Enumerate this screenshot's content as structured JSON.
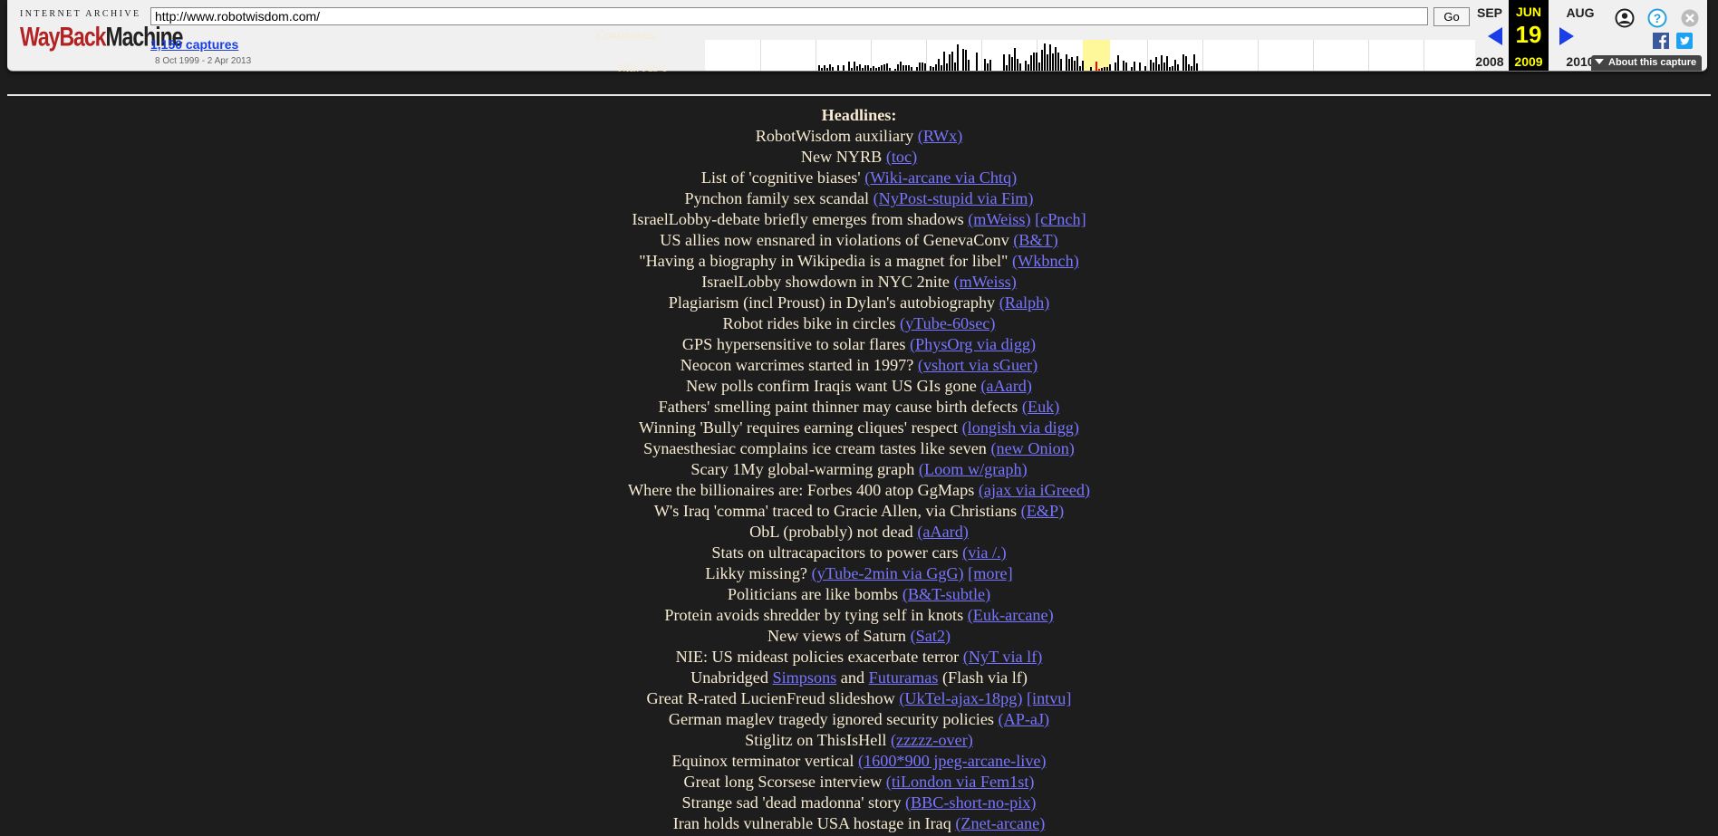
{
  "toolbar": {
    "logo_top": "INTERNET ARCHIVE",
    "logo_wb": "WayBack",
    "logo_mc": "Machine",
    "url": "http://www.robotwisdom.com/",
    "go_label": "Go",
    "captures_label": "1,150 captures",
    "date_range": "8 Oct 1999 - 2 Apr 2013",
    "ghost_continuous": "Continuous:",
    "ghost_nie": "NIE: Fab-1",
    "prev_month": "SEP",
    "prev_year": "2008",
    "current_month": "JUN",
    "current_day": "19",
    "current_year": "2009",
    "next_month": "AUG",
    "next_year": "2010",
    "about_label": "About this capture",
    "colors": {
      "link": "#1a3ee8",
      "highlight": "#ffff00",
      "logo_red": "#b22222"
    }
  },
  "page": {
    "heading": "Headlines:",
    "text_color": "#f6ead0",
    "link_color": "#7875ff",
    "background": "#1d1d1d"
  },
  "headlines": [
    {
      "text": "RobotWisdom auxiliary",
      "links": [
        "(RWx)"
      ]
    },
    {
      "text": "New NYRB",
      "links": [
        "(toc)"
      ]
    },
    {
      "text": "List of 'cognitive biases'",
      "links": [
        "(Wiki-arcane via Chtq)"
      ]
    },
    {
      "text": "Pynchon family sex scandal",
      "links": [
        "(NyPost-stupid via Fim)"
      ]
    },
    {
      "text": "IsraelLobby-debate briefly emerges from shadows",
      "links": [
        "(mWeiss)",
        "[cPnch]"
      ]
    },
    {
      "text": "US allies now ensnared in violations of GenevaConv",
      "links": [
        "(B&T)"
      ]
    },
    {
      "text": "\"Having a biography in Wikipedia is a magnet for libel\"",
      "links": [
        "(Wkbnch)"
      ]
    },
    {
      "text": "IsraelLobby showdown in NYC 2nite",
      "links": [
        "(mWeiss)"
      ]
    },
    {
      "text": "Plagiarism (incl Proust) in Dylan's autobiography",
      "links": [
        "(Ralph)"
      ]
    },
    {
      "text": "Robot rides bike in circles",
      "links": [
        "(yTube-60sec)"
      ]
    },
    {
      "text": "GPS hypersensitive to solar flares",
      "links": [
        "(PhysOrg via digg)"
      ]
    },
    {
      "text": "Neocon warcrimes started in 1997?",
      "links": [
        "(vshort via sGuer)"
      ]
    },
    {
      "text": "New polls confirm Iraqis want US GIs gone",
      "links": [
        "(aAard)"
      ]
    },
    {
      "text": "Fathers' smelling paint thinner may cause birth defects",
      "links": [
        "(Euk)"
      ]
    },
    {
      "text": "Winning 'Bully' requires earning cliques' respect",
      "links": [
        "(longish via digg)"
      ]
    },
    {
      "text": "Synaesthesiac complains ice cream tastes like seven",
      "links": [
        "(new Onion)"
      ]
    },
    {
      "text": "Scary 1My global-warming graph",
      "links": [
        "(Loom w/graph)"
      ]
    },
    {
      "text": "Where the billionaires are: Forbes 400 atop GgMaps",
      "links": [
        "(ajax via iGreed)"
      ]
    },
    {
      "text": "W's Iraq 'comma' traced to Gracie Allen, via Christians",
      "links": [
        "(E&P)"
      ]
    },
    {
      "text": "ObL (probably) not dead",
      "links": [
        "(aAard)"
      ]
    },
    {
      "text": "Stats on ultracapacitors to power cars",
      "links": [
        "(via /.)"
      ]
    },
    {
      "text": "Likky missing?",
      "links": [
        "(yTube-2min via GgG)",
        "[more]"
      ]
    },
    {
      "text": "Politicians are like bombs",
      "links": [
        "(B&T-subtle)"
      ]
    },
    {
      "text": "Protein avoids shredder by tying self in knots",
      "links": [
        "(Euk-arcane)"
      ]
    },
    {
      "text": "New views of Saturn",
      "links": [
        "(Sat2)"
      ]
    },
    {
      "text": "NIE: US mideast policies exacerbate terror",
      "links": [
        "(NyT via lf)"
      ]
    },
    {
      "segments": [
        {
          "t": "Unabridged ",
          "link": false
        },
        {
          "t": "Simpsons",
          "link": true
        },
        {
          "t": " and ",
          "link": false
        },
        {
          "t": "Futuramas",
          "link": true
        },
        {
          "t": " (Flash via lf)",
          "link": false
        }
      ]
    },
    {
      "text": "Great R-rated LucienFreud slideshow",
      "links": [
        "(UkTel-ajax-18pg)",
        "[intvu]"
      ]
    },
    {
      "text": "German maglev tragedy ignored security policies",
      "links": [
        "(AP-aJ)"
      ]
    },
    {
      "text": "Stiglitz on ThisIsHell",
      "links": [
        "(zzzzz-over)"
      ]
    },
    {
      "text": "Equinox terminator vertical",
      "links": [
        "(1600*900 jpeg-arcane-live)"
      ]
    },
    {
      "text": "Great long Scorsese interview",
      "links": [
        "(tiLondon via Fem1st)"
      ]
    },
    {
      "text": "Strange sad 'dead madonna' story",
      "links": [
        "(BBC-short-no-pix)"
      ]
    },
    {
      "text": "Iran holds vulnerable USA hostage in Iraq",
      "links": [
        "(Znet-arcane)"
      ]
    }
  ]
}
